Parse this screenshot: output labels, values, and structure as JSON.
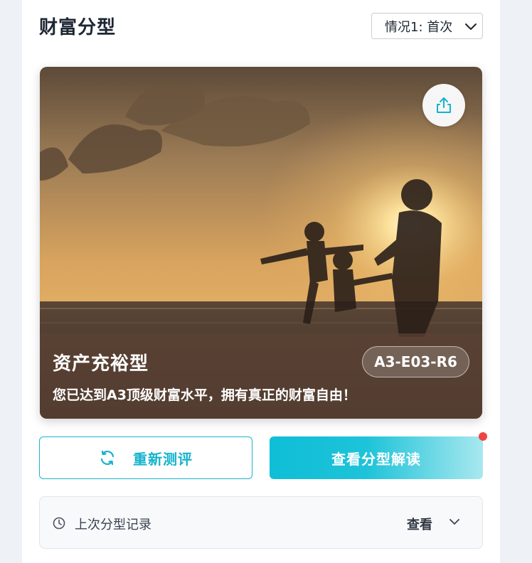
{
  "header": {
    "title": "财富分型",
    "scenario_select": "情况1: 首次"
  },
  "hero": {
    "image_description_icon": "family-sunset-beach-photo",
    "share_icon": "share-icon",
    "type_name": "资产充裕型",
    "type_code": "A3-E03-R6",
    "description": "您已达到A3顶级财富水平，拥有真正的财富自由！"
  },
  "actions": {
    "retest_label": "重新测评",
    "view_label": "查看分型解读",
    "accent_color": "#14b3cc",
    "notify_dot_color": "#ef4444"
  },
  "history": {
    "label": "上次分型记录",
    "view_label": "查看"
  }
}
